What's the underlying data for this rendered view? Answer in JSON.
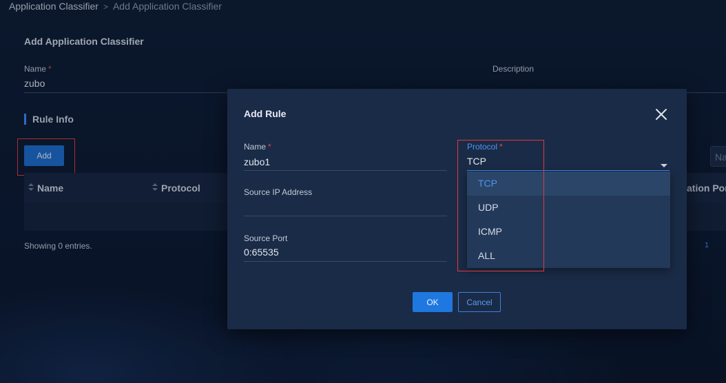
{
  "breadcrumb": {
    "root": "Application Classifier",
    "separator": ">",
    "current": "Add Application Classifier"
  },
  "page": {
    "section_title": "Add Application Classifier",
    "name_label": "Name",
    "required_mark": "*",
    "name_value": "zubo",
    "description_label": "Description",
    "rule_info_title": "Rule Info",
    "add_button": "Add",
    "table": {
      "columns": [
        "Name",
        "Protocol",
        "ation Por"
      ],
      "search_placeholder": "Na"
    },
    "entries_text": "Showing 0 entries.",
    "page_number": "1"
  },
  "modal": {
    "title": "Add Rule",
    "name_label": "Name",
    "name_value": "zubo1",
    "source_ip_label": "Source IP Address",
    "source_ip_value": "",
    "source_port_label": "Source Port",
    "source_port_value": "0:65535",
    "protocol_label": "Protocol",
    "protocol_value": "TCP",
    "protocol_options": [
      "TCP",
      "UDP",
      "ICMP",
      "ALL"
    ],
    "ok_button": "OK",
    "cancel_button": "Cancel"
  },
  "colors": {
    "accent": "#3d8bff",
    "primary_button": "#1e6dcd",
    "highlight_box": "#e23a3a",
    "required": "#e5484d"
  }
}
